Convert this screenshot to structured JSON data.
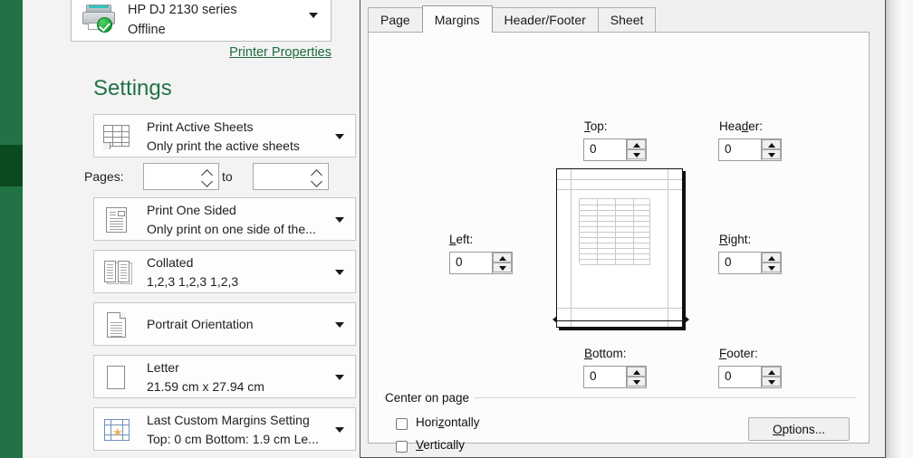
{
  "theme": {
    "excel_green": "#217346",
    "rail_active": "#0b4a1e",
    "link_green": "#1e6b3f",
    "pane_bg": "#f3f3f3",
    "dialog_bg": "#f0f0f0"
  },
  "print_pane": {
    "printer": {
      "name": "HP DJ 2130 series",
      "status": "Offline",
      "icon": "printer-icon",
      "status_badge": "green-check-badge",
      "dropdown_icon": "caret-down-icon"
    },
    "printer_properties_link": "Printer Properties",
    "settings_heading": "Settings",
    "settings": [
      {
        "icon": "print-area-grid-icon",
        "title": "Print Active Sheets",
        "subtitle": "Only print the active sheets",
        "dropdown_icon": "caret-down-icon"
      },
      {
        "icon": "one-sided-document-icon",
        "title": "Print One Sided",
        "subtitle": "Only print on one side of the...",
        "dropdown_icon": "caret-down-icon"
      },
      {
        "icon": "collated-pages-icon",
        "title": "Collated",
        "subtitle": "1,2,3   1,2,3   1,2,3",
        "dropdown_icon": "caret-down-icon"
      },
      {
        "icon": "portrait-page-icon",
        "title": "Portrait Orientation",
        "subtitle": "",
        "dropdown_icon": "caret-down-icon"
      },
      {
        "icon": "paper-size-icon",
        "title": "Letter",
        "subtitle": "21.59 cm x 27.94 cm",
        "dropdown_icon": "caret-down-icon"
      },
      {
        "icon": "custom-margins-icon",
        "title": "Last Custom Margins Setting",
        "subtitle": "Top: 0 cm Bottom: 1.9 cm Le...",
        "dropdown_icon": "caret-down-icon"
      }
    ],
    "pages_row": {
      "label": "Pages:",
      "from_value": "",
      "from_placeholder": "",
      "to_label": "to",
      "to_value": "",
      "to_placeholder": "",
      "spinner_up_icon": "chevron-up-icon",
      "spinner_down_icon": "chevron-down-icon"
    }
  },
  "dialog": {
    "tabs": [
      {
        "label": "Page",
        "active": false
      },
      {
        "label": "Margins",
        "active": true
      },
      {
        "label": "Header/Footer",
        "active": false
      },
      {
        "label": "Sheet",
        "active": false
      }
    ],
    "margins": {
      "top": {
        "label": "Top:",
        "accel": "T",
        "value": "0"
      },
      "header": {
        "label": "Header:",
        "accel": "d",
        "value": "0"
      },
      "left": {
        "label": "Left:",
        "accel": "L",
        "value": "0"
      },
      "right": {
        "label": "Right:",
        "accel": "R",
        "value": "0"
      },
      "bottom": {
        "label": "Bottom:",
        "accel": "B",
        "value": "0"
      },
      "footer": {
        "label": "Footer:",
        "accel": "F",
        "value": "0"
      },
      "spinner_up_icon": "triangle-up-icon",
      "spinner_down_icon": "triangle-down-icon"
    },
    "preview": {
      "name": "page-margin-preview",
      "handle_left_icon": "margin-drag-handle-left-icon",
      "handle_right_icon": "margin-drag-handle-right-icon"
    },
    "center_on_page": {
      "group_label": "Center on page",
      "horizontally": {
        "label": "Horizontally",
        "accel": "z",
        "checked": false
      },
      "vertically": {
        "label": "Vertically",
        "accel": "V",
        "checked": false
      }
    },
    "options_button": {
      "label": "Options...",
      "accel": "O"
    }
  }
}
